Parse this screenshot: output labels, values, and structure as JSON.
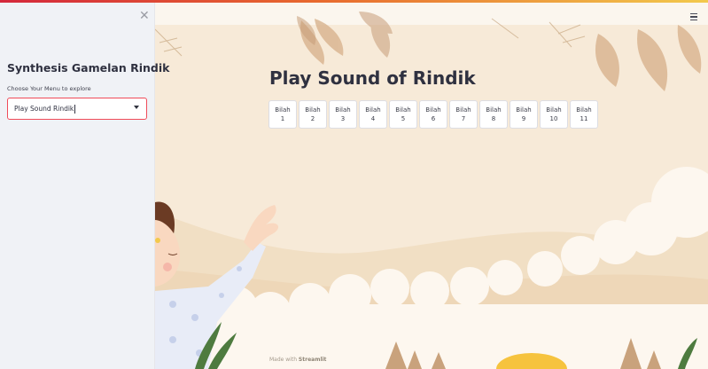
{
  "sidebar": {
    "close_icon": "close-icon",
    "app_title": "Synthesis Gamelan Rindik",
    "menu_label": "Choose Your Menu to explore",
    "menu_value": "Play Sound Rindik",
    "accent_color": "#ef4b59"
  },
  "header": {
    "menu_icon": "hamburger-icon"
  },
  "main": {
    "title": "Play Sound of Rindik",
    "bilah_buttons": [
      {
        "word": "Bilah",
        "num": "1"
      },
      {
        "word": "Bilah",
        "num": "2"
      },
      {
        "word": "Bilah",
        "num": "3"
      },
      {
        "word": "Bilah",
        "num": "4"
      },
      {
        "word": "Bilah",
        "num": "5"
      },
      {
        "word": "Bilah",
        "num": "6"
      },
      {
        "word": "Bilah",
        "num": "7"
      },
      {
        "word": "Bilah",
        "num": "8"
      },
      {
        "word": "Bilah",
        "num": "9"
      },
      {
        "word": "Bilah",
        "num": "10"
      },
      {
        "word": "Bilah",
        "num": "11"
      }
    ]
  },
  "footer": {
    "prefix": "Made with",
    "brand": "Streamlit"
  }
}
